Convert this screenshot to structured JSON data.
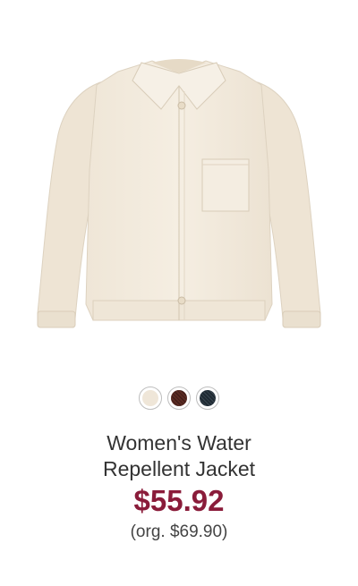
{
  "product": {
    "name_line1": "Women's Water",
    "name_line2": "Repellent Jacket",
    "price": "$55.92",
    "original_price": "(org. $69.90)",
    "image_icon": "jacket-image",
    "colors": {
      "jacket_body": "#f3ebde",
      "price_color": "#8a1c3a"
    },
    "swatches": [
      {
        "name": "ivory",
        "color": "#efe6d8"
      },
      {
        "name": "brown-stripe",
        "color": "#5a2a22"
      },
      {
        "name": "navy-check",
        "color": "#1f2a33"
      }
    ]
  }
}
